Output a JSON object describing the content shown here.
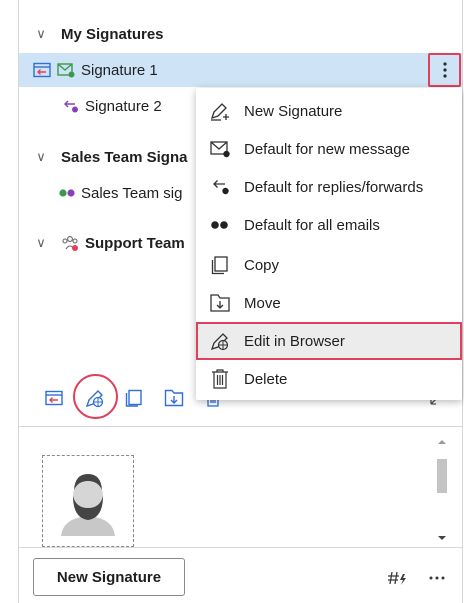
{
  "tree": {
    "groups": [
      {
        "label": "My Signatures"
      },
      {
        "label": "Sales Team Signa"
      },
      {
        "label": "Support Team"
      }
    ],
    "signatures": [
      {
        "label": "Signature 1"
      },
      {
        "label": "Signature 2"
      },
      {
        "label": "Sales Team sig"
      }
    ]
  },
  "context_menu": {
    "items": [
      {
        "label": "New Signature",
        "icon": "new-signature-icon"
      },
      {
        "label": "Default for new message",
        "icon": "envelope-icon"
      },
      {
        "label": "Default for replies/forwards",
        "icon": "reply-icon"
      },
      {
        "label": "Default for all emails",
        "icon": "dots-icon"
      },
      {
        "label": "Copy",
        "icon": "copy-icon"
      },
      {
        "label": "Move",
        "icon": "move-icon"
      },
      {
        "label": "Edit in Browser",
        "icon": "edit-in-browser-icon"
      },
      {
        "label": "Delete",
        "icon": "trash-icon"
      }
    ]
  },
  "footer": {
    "new_signature_label": "New Signature"
  },
  "colors": {
    "selected_row": "#cfe3f6",
    "highlight_border": "#e0405a",
    "accent_blue": "#2f6fd6",
    "green_dot": "#3a9a4a",
    "purple_dot": "#8a3fb8"
  }
}
